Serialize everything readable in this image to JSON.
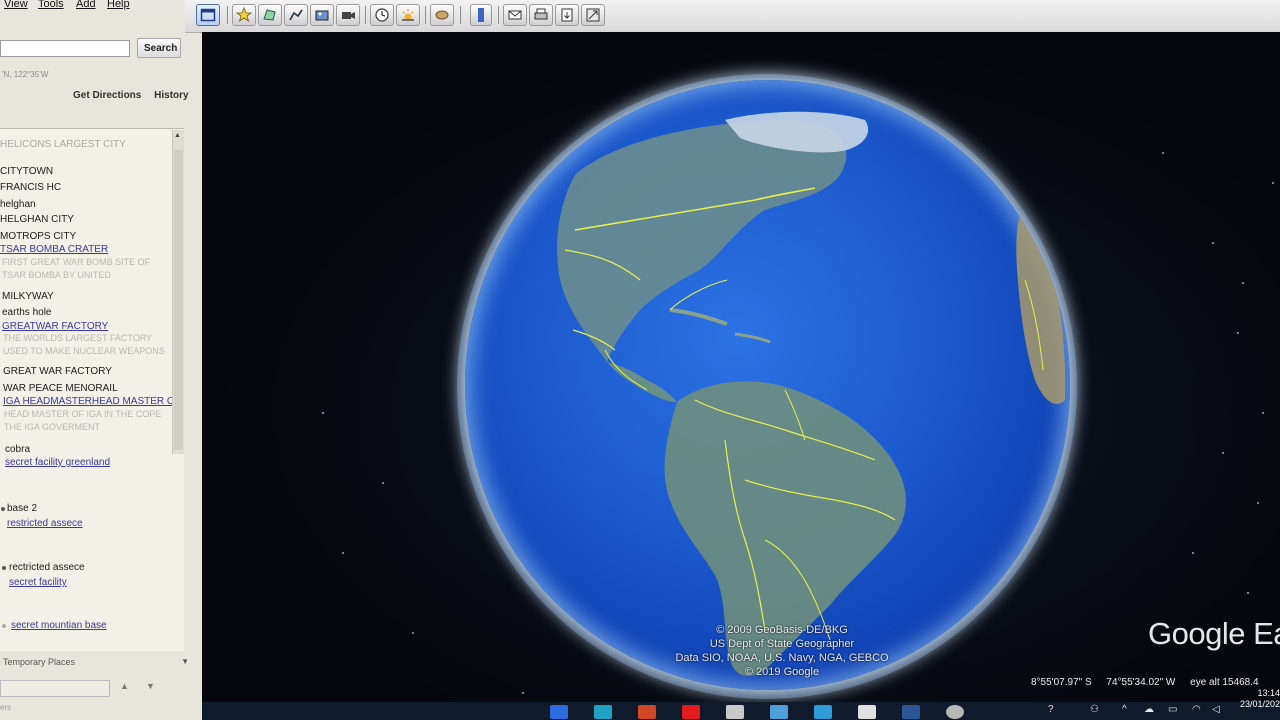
{
  "menu": {
    "items": [
      "View",
      "Tools",
      "Add",
      "Help"
    ]
  },
  "search": {
    "placeholder": "",
    "button_label": "Search",
    "coords_hint": "'N, 122°35'W"
  },
  "links": {
    "get_directions": "Get Directions",
    "history": "History"
  },
  "places": {
    "header": "HELICONS LARGEST CITY",
    "items": [
      {
        "label": "CITYTOWN",
        "style": "plain"
      },
      {
        "label": "FRANCIS HC",
        "style": "plain"
      },
      {
        "label": "helghan",
        "style": "plain"
      },
      {
        "label": "HELGHAN CITY",
        "style": "plain"
      },
      {
        "label": "MOTROPS CITY",
        "style": "plain"
      },
      {
        "label": "TSAR BOMBA CRATER",
        "style": "link"
      },
      {
        "label": "FIRST GREAT WAR BOMB SITE OF",
        "style": "faded"
      },
      {
        "label": "TSAR BOMBA BY UNITED",
        "style": "faded"
      },
      {
        "label": "MILKYWAY",
        "style": "plain"
      },
      {
        "label": "earths hole",
        "style": "plain"
      },
      {
        "label": "GREATWAR FACTORY",
        "style": "link"
      },
      {
        "label": "THE WORLDS LARGEST FACTORY",
        "style": "faded"
      },
      {
        "label": "USED TO MAKE NUCLEAR WEAPONS",
        "style": "faded"
      },
      {
        "label": "GREAT WAR FACTORY",
        "style": "plain"
      },
      {
        "label": "WAR PEACE MENORAIL",
        "style": "plain"
      },
      {
        "label": "IGA HEADMASTERHEAD MASTER OF",
        "style": "link"
      },
      {
        "label": "HEAD MASTER OF IGA IN THE COPE",
        "style": "faded"
      },
      {
        "label": "THE IGA GOVERMENT",
        "style": "faded"
      },
      {
        "label": "cobra",
        "style": "plain"
      },
      {
        "label": "secret facility greenland",
        "style": "link"
      },
      {
        "label": "base 2",
        "style": "plain"
      },
      {
        "label": "restricted assece",
        "style": "link"
      },
      {
        "label": "rectricted assece",
        "style": "plain"
      },
      {
        "label": "secret facility",
        "style": "link"
      },
      {
        "label": "secret mountian base",
        "style": "link"
      }
    ],
    "temporary": "Temporary Places"
  },
  "earth": {
    "attribution": [
      "© 2009 GeoBasis-DE/BKG",
      "US Dept of State Geographer",
      "Data SIO, NOAA, U.S. Navy, NGA, GEBCO",
      "© 2019 Google"
    ],
    "brand": "Google Ea",
    "status": {
      "lat": "8°55'07.97\" S",
      "lon": "74°55'34.02\" W",
      "eye": "eye alt 15468.4"
    }
  },
  "taskbar": {
    "time": "13:14",
    "date": "23/01/202"
  },
  "colors": {
    "ocean": "#1a58cc",
    "border_lines": "#e8f04a",
    "land": "#5f8a8a"
  }
}
